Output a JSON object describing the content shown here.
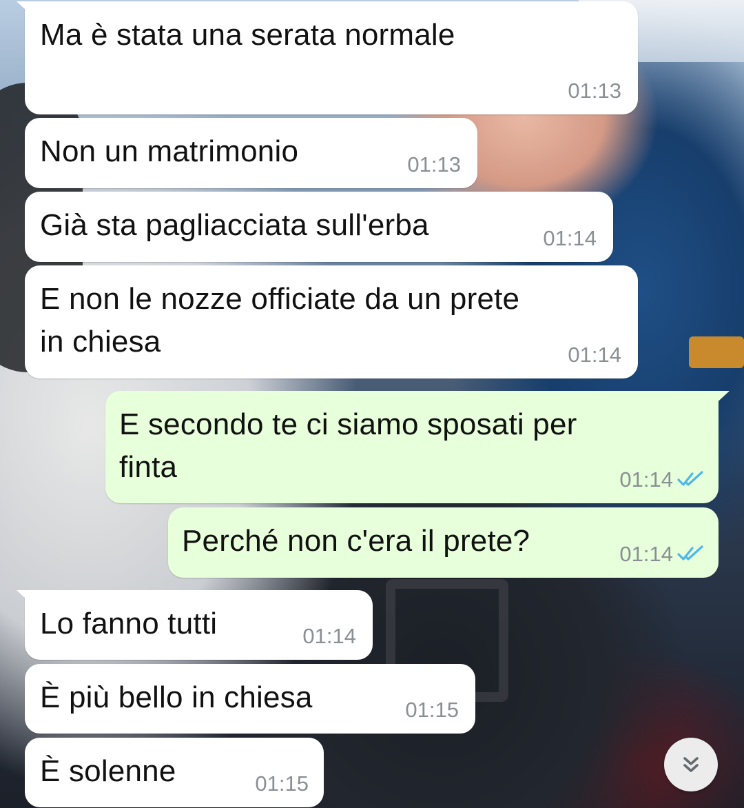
{
  "messages": [
    {
      "text": "Ma è stata una serata normale",
      "time": "01:13",
      "direction": "in"
    },
    {
      "text": "Non un matrimonio",
      "time": "01:13",
      "direction": "in"
    },
    {
      "text": "Già sta pagliacciata sull'erba",
      "time": "01:14",
      "direction": "in"
    },
    {
      "text_lines": [
        "E non le nozze officiate da un prete",
        "in chiesa"
      ],
      "time": "01:14",
      "direction": "in"
    },
    {
      "text_lines": [
        "E secondo te ci siamo sposati per",
        "finta"
      ],
      "time": "01:14",
      "direction": "out",
      "status": "read"
    },
    {
      "text": "Perché non c'era il prete?",
      "time": "01:14",
      "direction": "out",
      "status": "read"
    },
    {
      "text": "Lo fanno tutti",
      "time": "01:14",
      "direction": "in"
    },
    {
      "text": "È più bello in chiesa",
      "time": "01:15",
      "direction": "in"
    },
    {
      "text": "È solenne",
      "time": "01:15",
      "direction": "in"
    }
  ],
  "icons": {
    "read_ticks": "double-check-icon",
    "scroll_down": "chevron-double-down-icon"
  },
  "colors": {
    "incoming_bubble": "#ffffff",
    "outgoing_bubble": "#e7ffdb",
    "timestamp": "#8a8f93",
    "read_ticks": "#4fb6ec"
  }
}
